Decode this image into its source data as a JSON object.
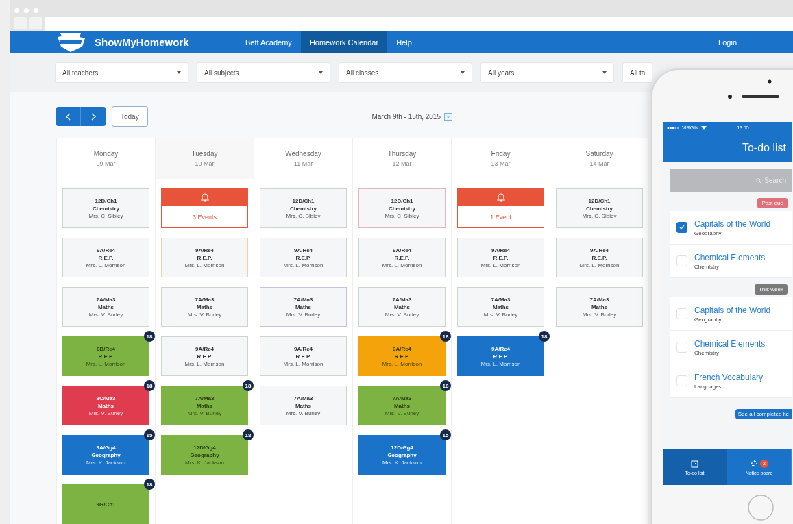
{
  "brand": "ShowMyHomework",
  "nav": [
    {
      "label": "Bett Academy",
      "selected": false
    },
    {
      "label": "Homework Calendar",
      "selected": true
    },
    {
      "label": "Help",
      "selected": false
    }
  ],
  "login": "Login",
  "filters": [
    {
      "value": "All teachers"
    },
    {
      "value": "All subjects"
    },
    {
      "value": "All classes"
    },
    {
      "value": "All years"
    },
    {
      "value": "All ta"
    }
  ],
  "toolbar": {
    "today": "Today",
    "range": "March 9th - 15th, 2015"
  },
  "days": [
    {
      "name": "Monday",
      "date": "09 Mar",
      "cards": [
        {
          "kind": "plain",
          "color": "#c9d6c9",
          "code": "12D/Ch1",
          "subject": "Chemistry",
          "teacher": "Mrs. C. Sibley"
        },
        {
          "kind": "plain",
          "color": "#c9d6c9",
          "code": "9A/Re4",
          "subject": "R.E.P.",
          "teacher": "Mrs. L. Morrison"
        },
        {
          "kind": "plain",
          "color": "#c9d6c9",
          "code": "7A/Ma3",
          "subject": "Maths",
          "teacher": "Mrs. V. Burley"
        },
        {
          "kind": "filled",
          "color": "#7cb342",
          "code": "8B/Re4",
          "subject": "R.E.P.",
          "teacher": "Mrs. L. Morrison",
          "badge": "18"
        },
        {
          "kind": "filled",
          "color": "#e03c4f",
          "code": "8C/Ma3",
          "subject": "Maths",
          "teacher": "Mrs. V. Burley",
          "badge": "18"
        },
        {
          "kind": "filled",
          "color": "#1a73c8",
          "code": "9A/Gg4",
          "subject": "Geography",
          "teacher": "Mrs. K. Jackson",
          "badge": "15"
        },
        {
          "kind": "filled",
          "color": "#7cb342",
          "code": "9G/Ch1",
          "badge": "18"
        }
      ]
    },
    {
      "name": "Tuesday",
      "date": "10 Mar",
      "cards": [
        {
          "kind": "event",
          "color": "#e8543a",
          "label": "3 Events"
        },
        {
          "kind": "plain",
          "color": "#f0d2a8",
          "code": "9A/Re4",
          "subject": "R.E.P.",
          "teacher": "Mrs. L. Morrison"
        },
        {
          "kind": "plain",
          "color": "#c9d6c9",
          "code": "7A/Ma3",
          "subject": "Maths",
          "teacher": "Mrs. V. Burley"
        },
        {
          "kind": "plain",
          "color": "#c9d6c9",
          "code": "9A/Re4",
          "subject": "R.E.P.",
          "teacher": "Mrs. L. Morrison"
        },
        {
          "kind": "filled",
          "color": "#7cb342",
          "code": "7A/Ma3",
          "subject": "Maths",
          "teacher": "Mrs. V. Burley",
          "badge": "18"
        },
        {
          "kind": "filled",
          "color": "#7cb342",
          "code": "12D/Gg4",
          "subject": "Geography",
          "teacher": "Mrs. K. Jackson",
          "badge": "18"
        }
      ]
    },
    {
      "name": "Wednesday",
      "date": "11 Mar",
      "cards": [
        {
          "kind": "plain",
          "color": "#c9d6c9",
          "code": "12D/Ch1",
          "subject": "Chemistry",
          "teacher": "Mrs. C. Sibley"
        },
        {
          "kind": "plain",
          "color": "#c9d6c9",
          "code": "9A/Re4",
          "subject": "R.E.P.",
          "teacher": "Mrs. L. Morrison"
        },
        {
          "kind": "plain",
          "color": "#c8c0e0",
          "code": "7A/Ma3",
          "subject": "Maths",
          "teacher": "Mrs. V. Burley"
        },
        {
          "kind": "plain",
          "color": "#c9d6c9",
          "code": "9A/Re4",
          "subject": "R.E.P.",
          "teacher": "Mrs. L. Morrison"
        },
        {
          "kind": "plain",
          "color": "#c9d6c9",
          "code": "7A/Ma3",
          "subject": "Maths",
          "teacher": "Mrs. V. Burley"
        }
      ]
    },
    {
      "name": "Thursday",
      "date": "12 Mar",
      "cards": [
        {
          "kind": "plain",
          "color": "#e8b4bc",
          "code": "12D/Ch1",
          "subject": "Chemistry",
          "teacher": "Mrs. C. Sibley"
        },
        {
          "kind": "plain",
          "color": "#c9d6c9",
          "code": "9A/Re4",
          "subject": "R.E.P.",
          "teacher": "Mrs. L. Morrison"
        },
        {
          "kind": "plain",
          "color": "#c9d6c9",
          "code": "7A/Ma3",
          "subject": "Maths",
          "teacher": "Mrs. V. Burley"
        },
        {
          "kind": "filled",
          "color": "#f5a30a",
          "code": "9A/Re4",
          "subject": "R.E.P.",
          "teacher": "Mrs. L. Morrison",
          "badge": "18"
        },
        {
          "kind": "filled",
          "color": "#7cb342",
          "code": "7A/Ma3",
          "subject": "Maths",
          "teacher": "Mrs. V. Burley",
          "badge": "18"
        },
        {
          "kind": "filled",
          "color": "#1a73c8",
          "code": "12D/Gg4",
          "subject": "Geography",
          "teacher": "Mrs. K. Jackson",
          "badge": "15"
        }
      ]
    },
    {
      "name": "Friday",
      "date": "13 Mar",
      "cards": [
        {
          "kind": "event",
          "color": "#e8543a",
          "label": "1 Event"
        },
        {
          "kind": "plain",
          "color": "#c9d6c9",
          "code": "9A/Re4",
          "subject": "R.E.P.",
          "teacher": "Mrs. L. Morrison"
        },
        {
          "kind": "plain",
          "color": "#c9d6c9",
          "code": "7A/Ma3",
          "subject": "Maths",
          "teacher": "Mrs. V. Burley"
        },
        {
          "kind": "filled",
          "color": "#1a73c8",
          "code": "9A/Re4",
          "subject": "R.E.P.",
          "teacher": "Mrs. L. Morrison",
          "badge": "18"
        }
      ]
    },
    {
      "name": "Saturday",
      "date": "14 Mar",
      "cards": [
        {
          "kind": "plain",
          "color": "#c9d6c9",
          "code": "12D/Ch1",
          "subject": "Chemistry",
          "teacher": "Mrs. C. Sibley"
        },
        {
          "kind": "plain",
          "color": "#c9d6c9",
          "code": "9A/Re4",
          "subject": "R.E.P.",
          "teacher": "Mrs. L. Morrison"
        },
        {
          "kind": "plain",
          "color": "#c9d6c9",
          "code": "7A/Ma3",
          "subject": "Maths",
          "teacher": "Mrs. V. Burley"
        }
      ]
    }
  ],
  "phone": {
    "carrier": "VIRGIN",
    "time": "13:05",
    "title": "To-do list",
    "search": {
      "placeholder": "Search"
    },
    "groups": [
      {
        "label": "Past due",
        "color": "#e0707a",
        "items": [
          {
            "title": "Capitals of the World",
            "subject": "Geography",
            "checked": true
          },
          {
            "title": "Chemical Elements",
            "subject": "Chemistry",
            "checked": false
          }
        ]
      },
      {
        "label": "This week",
        "color": "#7a7a7a",
        "items": [
          {
            "title": "Capitals of the World",
            "subject": "Geography",
            "checked": false
          },
          {
            "title": "Chemical Elements",
            "subject": "Chemistry",
            "checked": false
          },
          {
            "title": "French Vocabulary",
            "subject": "Languages",
            "checked": false
          }
        ]
      }
    ],
    "see_all": "See all completed ite",
    "tabs": [
      {
        "label": "To-do list",
        "selected": true
      },
      {
        "label": "Notice board",
        "selected": false,
        "badge": "2"
      }
    ]
  }
}
